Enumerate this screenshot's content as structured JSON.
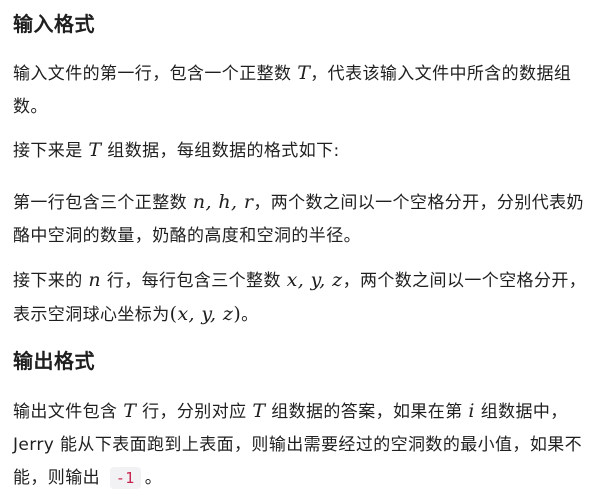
{
  "sections": {
    "input_heading": "输入格式",
    "output_heading": "输出格式"
  },
  "paragraphs": {
    "p1": {
      "a": "输入文件的第一行，包含一个正整数 ",
      "var_t": "T",
      "b": "，代表该输入文件中所含的数据组数。"
    },
    "p2": {
      "a": "接下来是 ",
      "var_t": "T",
      "b": " 组数据，每组数据的格式如下:"
    },
    "p3": {
      "a": "第一行包含三个正整数 ",
      "vars": "n, h, r",
      "b": "，两个数之间以一个空格分开，分别代表奶酪中空洞的数量，奶酪的高度和空洞的半径。"
    },
    "p4": {
      "a": "接下来的 ",
      "var_n": "n",
      "b": " 行，每行包含三个整数 ",
      "vars": "x, y, z",
      "c": "，两个数之间以一个空格分开，表示空洞球心坐标为",
      "open": "(",
      "coords": "x, y, z",
      "close": ")",
      "d": "。"
    },
    "p5": {
      "a": "输出文件包含 ",
      "var_t1": "T",
      "b": " 行，分别对应 ",
      "var_t2": "T",
      "c": " 组数据的答案，如果在第 ",
      "var_i": "i",
      "d": " 组数据中，Jerry 能从下表面跑到上表面，则输出需要经过的空洞数的最小值，如果不能，则输出 ",
      "code": "-1",
      "e": "。"
    }
  }
}
